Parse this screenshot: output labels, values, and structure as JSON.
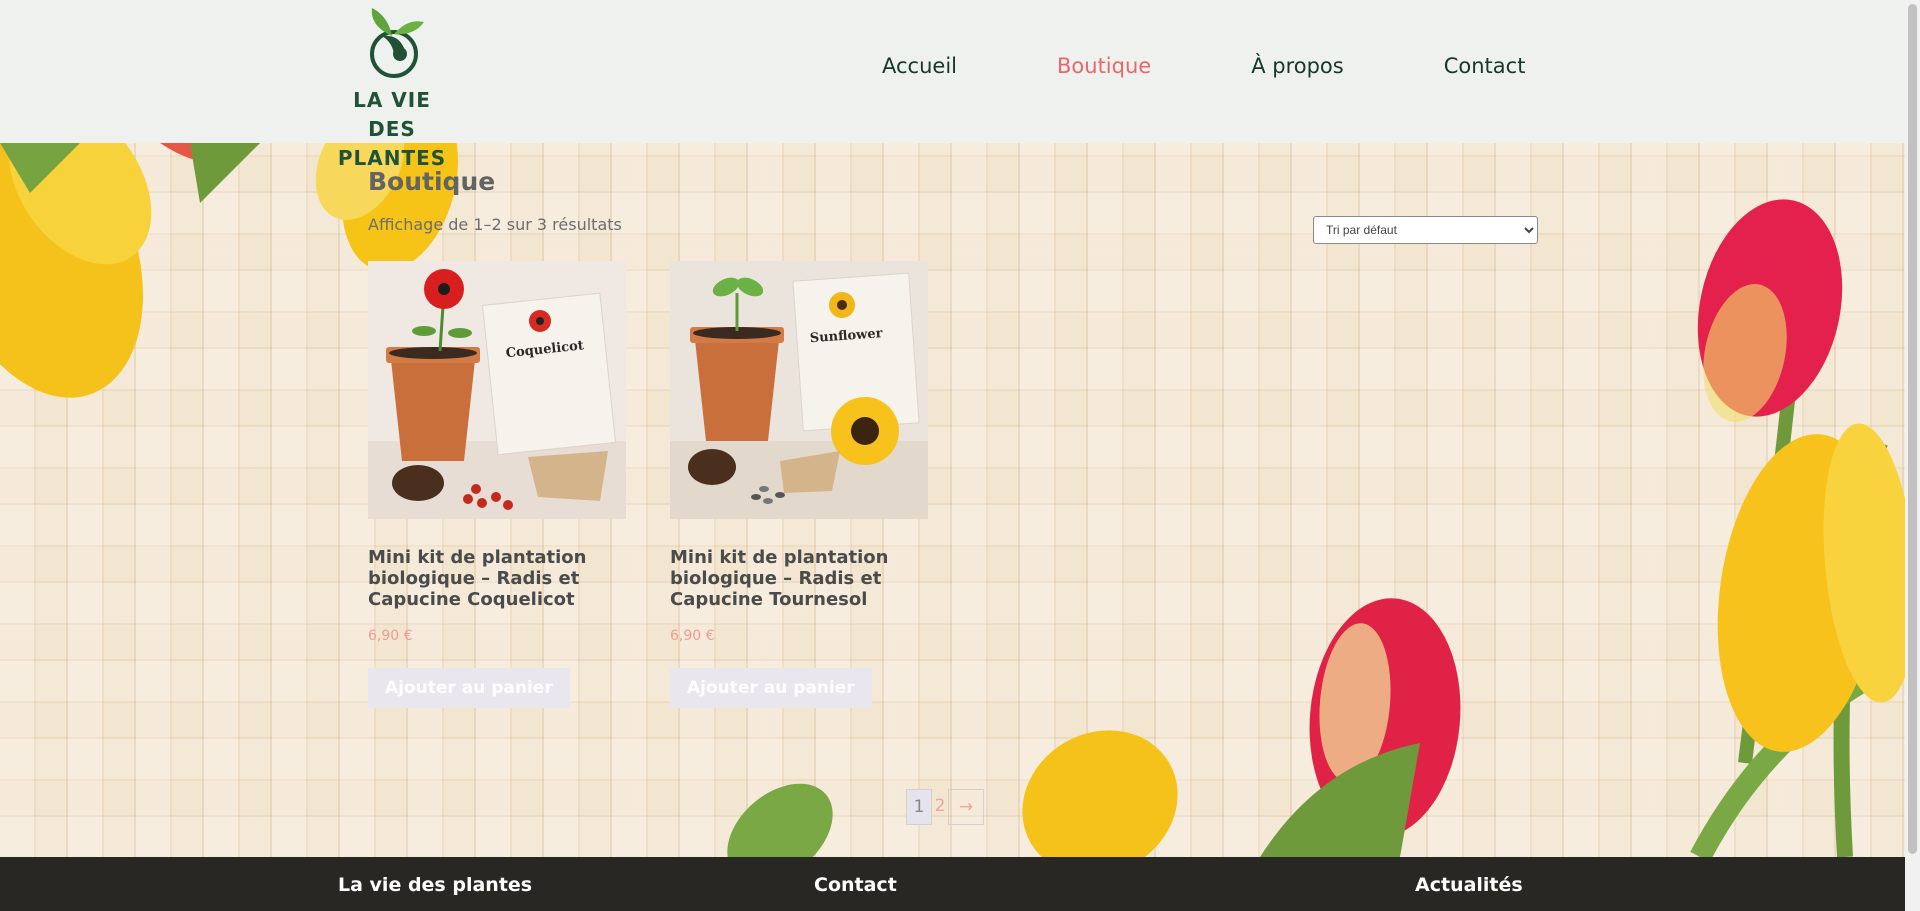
{
  "brand": {
    "logo_line1": "LA VIE DES",
    "logo_line2": "PLANTES"
  },
  "nav": {
    "items": [
      {
        "label": "Accueil",
        "active": false
      },
      {
        "label": "Boutique",
        "active": true
      },
      {
        "label": "À propos",
        "active": false
      },
      {
        "label": "Contact",
        "active": false
      }
    ]
  },
  "shop": {
    "title": "Boutique",
    "result_count": "Affichage de 1–2 sur 3 résultats",
    "sort_selected": "Tri par défaut",
    "products": [
      {
        "title": "Mini kit de plantation biologique – Radis et Capucine Coquelicot",
        "price": "6,90 €",
        "button": "Ajouter au panier",
        "card_label": "Coquelicot"
      },
      {
        "title": "Mini kit de plantation biologique – Radis et Capucine Tournesol",
        "price": "6,90 €",
        "button": "Ajouter au panier",
        "card_label": "Sunflower"
      }
    ],
    "pagination": {
      "current": "1",
      "next_page": "2",
      "next_arrow": "→"
    }
  },
  "footer": {
    "col1": "La vie des plantes",
    "col2": "Contact",
    "col3": "Actualités"
  },
  "colors": {
    "accent": "#e8676a",
    "brand_green": "#1f5237",
    "header_bg": "#eef1ed",
    "footer_bg": "#292724",
    "price": "#f19a93"
  }
}
